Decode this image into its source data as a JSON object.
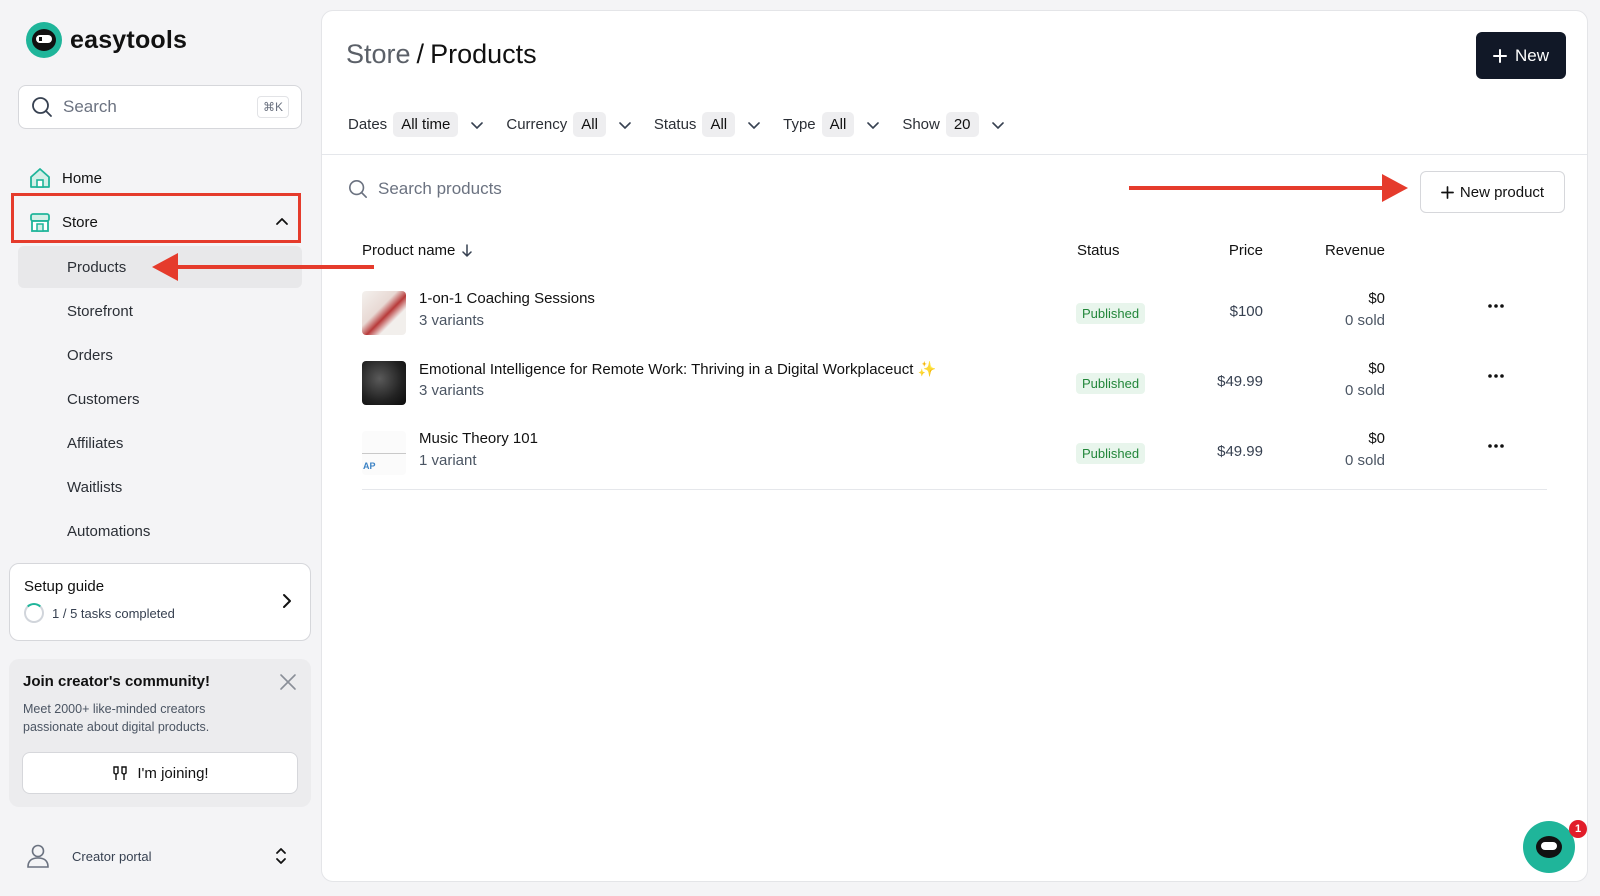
{
  "brand": {
    "name": "easytools",
    "accent": "#1fb59a"
  },
  "sidebar": {
    "search": {
      "placeholder": "Search",
      "shortcut": "⌘K"
    },
    "nav": {
      "home": "Home",
      "store": "Store"
    },
    "store_items": [
      "Products",
      "Storefront",
      "Orders",
      "Customers",
      "Affiliates",
      "Waitlists",
      "Automations"
    ],
    "setup": {
      "title": "Setup guide",
      "progress": "1 / 5 tasks completed",
      "completed_fraction": 0.2
    },
    "community": {
      "title": "Join creator's community!",
      "description": "Meet 2000+ like-minded creators passionate about digital products.",
      "button": "I'm joining!"
    },
    "portal": {
      "label": "Creator portal"
    }
  },
  "header": {
    "breadcrumb_parent": "Store",
    "breadcrumb_sep": "/",
    "title": "Products",
    "new_button": "New"
  },
  "filters": [
    {
      "label": "Dates",
      "value": "All time"
    },
    {
      "label": "Currency",
      "value": "All"
    },
    {
      "label": "Status",
      "value": "All"
    },
    {
      "label": "Type",
      "value": "All"
    },
    {
      "label": "Show",
      "value": "20"
    }
  ],
  "products": {
    "search_placeholder": "Search products",
    "new_product_button": "New product",
    "columns": {
      "name": "Product name",
      "status": "Status",
      "price": "Price",
      "revenue": "Revenue"
    },
    "rows": [
      {
        "name": "1-on-1 Coaching Sessions",
        "variants": "3 variants",
        "status": "Published",
        "price": "$100",
        "revenue": "$0",
        "sold": "0 sold"
      },
      {
        "name": "Emotional Intelligence for Remote Work: Thriving in a Digital Workplaceuct ✨",
        "variants": "3 variants",
        "status": "Published",
        "price": "$49.99",
        "revenue": "$0",
        "sold": "0 sold"
      },
      {
        "name": "Music Theory 101",
        "variants": "1 variant",
        "status": "Published",
        "price": "$49.99",
        "revenue": "$0",
        "sold": "0 sold"
      }
    ],
    "thumb3_text": "AP"
  },
  "chat": {
    "badge_count": "1"
  },
  "annotation_color": "#e53b2c"
}
